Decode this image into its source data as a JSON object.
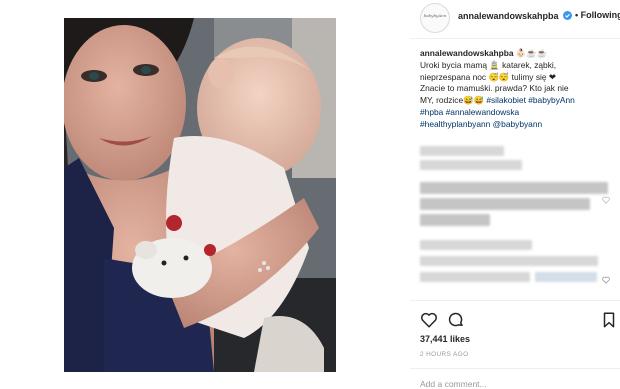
{
  "post": {
    "username": "annalewandowskahpba",
    "follow_label": "• Following",
    "caption": {
      "username": "annalewandowskahpba",
      "emoji": "👶🏻☕☕",
      "line1": "Uroki bycia mamą 🚊 katarek, ząbki,",
      "line2": "nieprzespana noc 😴😴 tulimy się ❤",
      "line3": "Znacie to mamuśki. prawda? Kto jak nie",
      "line4_text": "MY, rodzice😅😅",
      "tag1": "#silakobiet",
      "tag2": "#babybyAnn",
      "tag3": "#hpba",
      "tag4": "#annalewandowska",
      "tag5": "#healthyplanbyann",
      "tag6": "@babybyann"
    },
    "likes": "37,441 likes",
    "time_ago": "2 HOURS AGO",
    "add_comment_placeholder": "Add a comment..."
  },
  "icons": {
    "verified": "verified-badge-icon",
    "like": "heart-icon",
    "comment": "comment-icon",
    "save": "bookmark-icon",
    "more": "more-options-icon"
  },
  "colors": {
    "link": "#003569",
    "verified": "#3897f0",
    "text": "#262626",
    "muted": "#999999"
  }
}
